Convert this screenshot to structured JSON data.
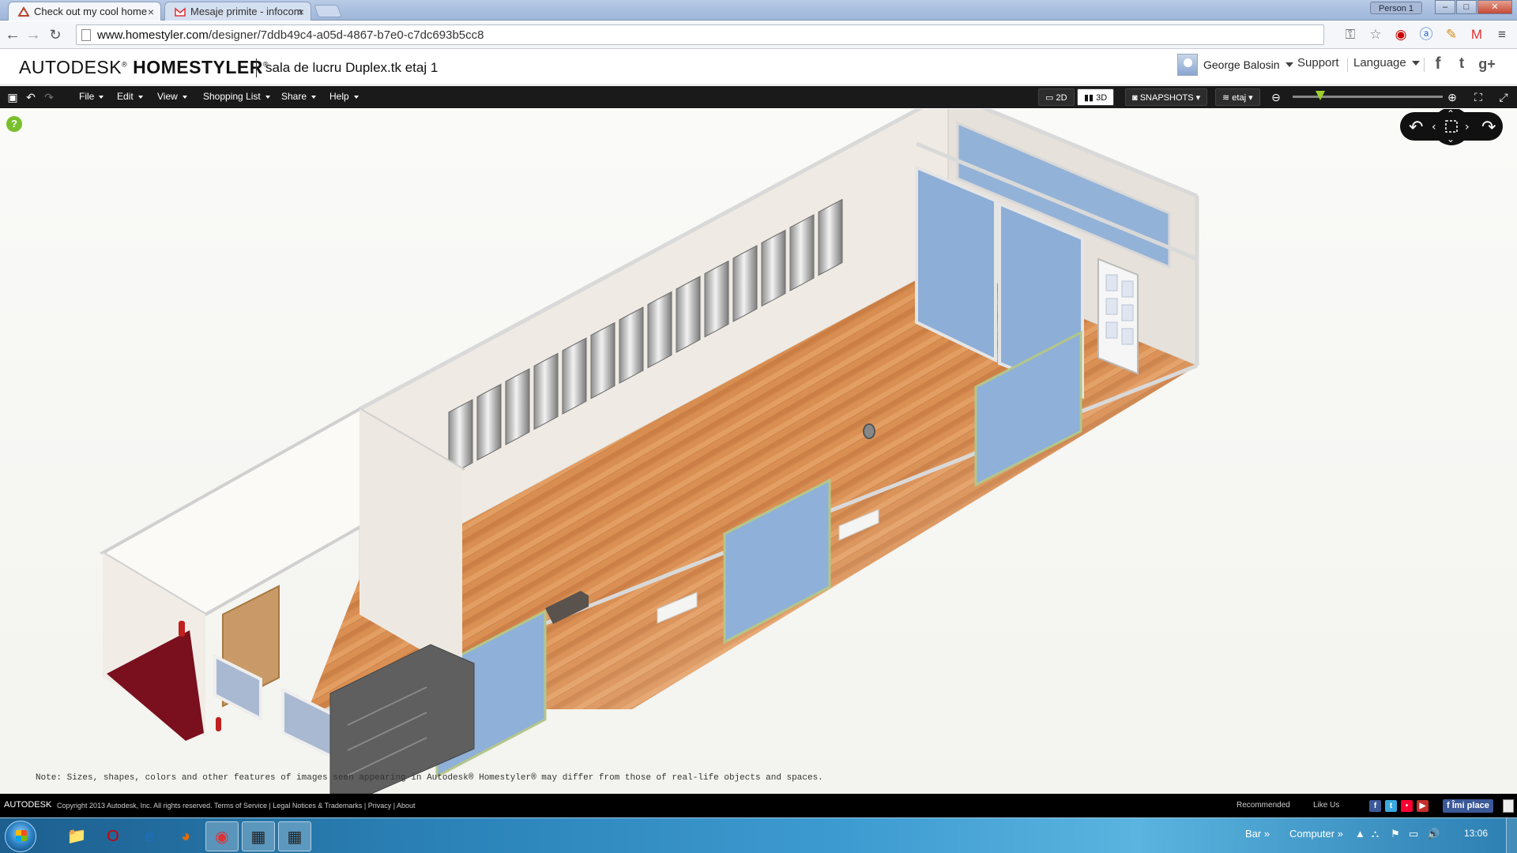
{
  "browser": {
    "tabs": [
      {
        "title": "Check out my cool home",
        "active": true
      },
      {
        "title": "Mesaje primite - infocom",
        "active": false
      }
    ],
    "person": "Person 1",
    "url_host": "www.homestyler.com",
    "url_path": "/designer/7ddb49c4-a05d-4867-b7e0-c7dc693b5cc8"
  },
  "header": {
    "brand": "AUTODESK",
    "product": "HOMESTYLER",
    "project_name": "sala de lucru Duplex.tk etaj 1",
    "user_name": "George Balosin",
    "support": "Support",
    "language": "Language",
    "social": [
      "f",
      "t",
      "g+"
    ]
  },
  "menubar": {
    "menus": [
      "File",
      "Edit",
      "View",
      "Shopping List",
      "Share",
      "Help"
    ],
    "view_2d": "2D",
    "view_3d": "3D",
    "snapshots": "SNAPSHOTS",
    "level": "etaj"
  },
  "canvas": {
    "help": "?",
    "note": "Note: Sizes, shapes, colors and other features of images seen appearing in Autodesk® Homestyler® may differ from those of real-life objects and spaces."
  },
  "footer": {
    "brand": "AUTODESK",
    "copyright": "Copyright 2013 Autodesk, Inc. All rights reserved. Terms of Service | Legal Notices & Trademarks | Privacy | About",
    "recommended": "Recommended",
    "like_us": "Like Us",
    "like_button": "Îmi place"
  },
  "taskbar": {
    "bar_label": "Bar",
    "computer_label": "Computer",
    "clock": "13:06"
  },
  "colors": {
    "menubar": "#1a1a1a",
    "floor": "#d9884a",
    "glass": "#8fb0d8",
    "carpet": "#7a0f1e",
    "accent_green": "#78c02c"
  }
}
